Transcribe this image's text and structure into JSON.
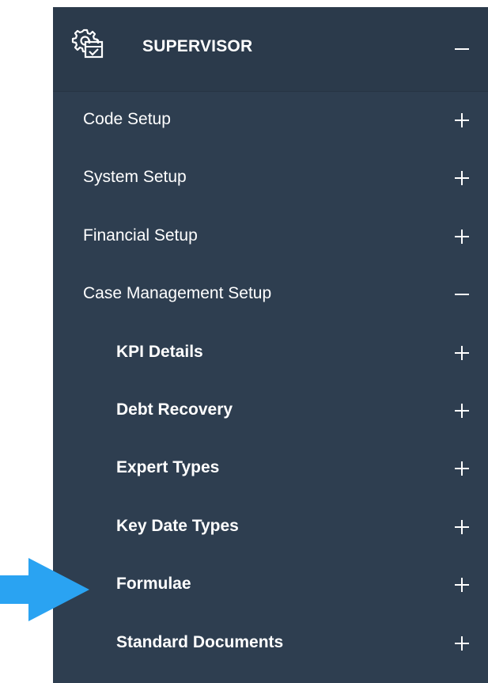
{
  "header": {
    "title": "SUPERVISOR",
    "icon": "settings-calendar-icon",
    "toggle": "minus"
  },
  "menu": [
    {
      "label": "Code Setup",
      "toggle": "plus",
      "level": 1
    },
    {
      "label": "System Setup",
      "toggle": "plus",
      "level": 1
    },
    {
      "label": "Financial Setup",
      "toggle": "plus",
      "level": 1
    },
    {
      "label": "Case Management Setup",
      "toggle": "minus",
      "level": 1
    },
    {
      "label": "KPI Details",
      "toggle": "plus",
      "level": 2
    },
    {
      "label": "Debt Recovery",
      "toggle": "plus",
      "level": 2
    },
    {
      "label": "Expert Types",
      "toggle": "plus",
      "level": 2
    },
    {
      "label": "Key Date Types",
      "toggle": "plus",
      "level": 2
    },
    {
      "label": "Formulae",
      "toggle": "plus",
      "level": 2
    },
    {
      "label": "Standard Documents",
      "toggle": "plus",
      "level": 2
    }
  ],
  "colors": {
    "panel": "#2e3e50",
    "header": "#2b3a4b",
    "text": "#ffffff",
    "arrow": "#2aa3f2"
  },
  "annotation": {
    "icon": "blue-arrow-pointer-icon",
    "points_to": "Formulae"
  }
}
